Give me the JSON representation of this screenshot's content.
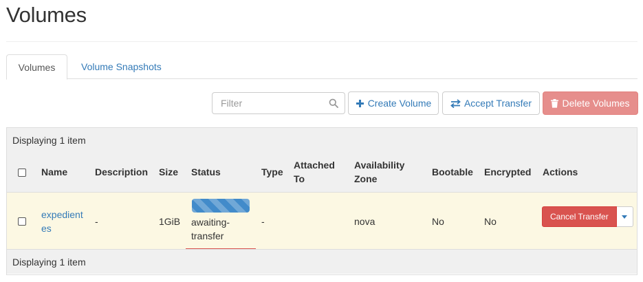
{
  "page": {
    "title": "Volumes"
  },
  "tabs": [
    {
      "label": "Volumes",
      "active": true
    },
    {
      "label": "Volume Snapshots",
      "active": false
    }
  ],
  "toolbar": {
    "filter_placeholder": "Filter",
    "create_label": "Create Volume",
    "accept_label": "Accept Transfer",
    "delete_label": "Delete Volumes"
  },
  "table": {
    "count_text": "Displaying 1 item",
    "columns": {
      "name": "Name",
      "description": "Description",
      "size": "Size",
      "status": "Status",
      "type": "Type",
      "attached_line1": "Attached",
      "attached_line2": "To",
      "zone_line1": "Availability",
      "zone_line2": "Zone",
      "bootable": "Bootable",
      "encrypted": "Encrypted",
      "actions": "Actions"
    },
    "rows": [
      {
        "name_line1": "expedient",
        "name_line2": "es",
        "description": "-",
        "size": "1GiB",
        "status_line1": "awaiting-",
        "status_line2": "transfer",
        "type": "-",
        "attached_to": "",
        "availability_zone": "nova",
        "bootable": "No",
        "encrypted": "No",
        "action_label": "Cancel Transfer"
      }
    ]
  },
  "icons": {
    "filter": "search-icon",
    "create": "plus-icon",
    "accept": "exchange-icon",
    "delete": "trash-icon",
    "action_menu": "caret-down-icon"
  },
  "colors": {
    "link": "#337ab7",
    "danger": "#d9534f",
    "row_highlight": "#fcf8e3",
    "progress": "#428bca"
  }
}
